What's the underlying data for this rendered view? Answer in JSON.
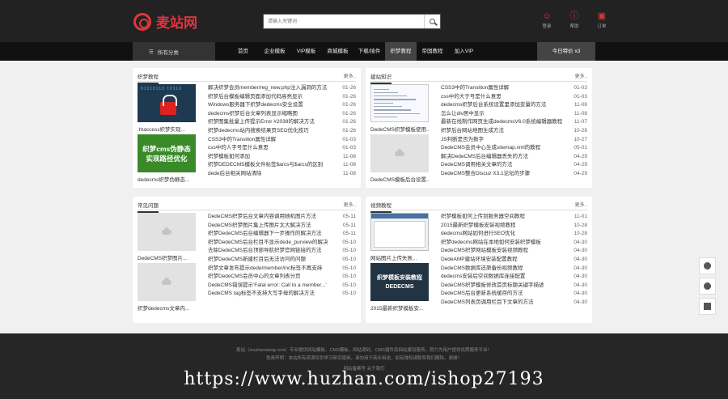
{
  "header": {
    "logo_text": "麦站网",
    "search_placeholder": "请输入关键词",
    "icons": [
      {
        "icon": "user-icon",
        "label": "登录"
      },
      {
        "icon": "help-icon",
        "label": "帮助"
      },
      {
        "icon": "cart-icon",
        "label": "订单"
      }
    ]
  },
  "nav": {
    "all_label": "所有分类",
    "items": [
      "首页",
      "企业模板",
      "VIP模板",
      "商城模板",
      "下载/插件",
      "织梦教程",
      "帝国教程"
    ],
    "active_index": 5,
    "extra": "加入VIP",
    "vip_label": "今日特价 x3"
  },
  "panels": [
    {
      "title": "织梦教程",
      "more": "更多..",
      "thumbs": [
        {
          "caption": ".htaccess织梦实现...",
          "style": "lock",
          "art": "01010110 10110"
        },
        {
          "caption": "dedecms织梦伪静态...",
          "style": "green",
          "art_lines": [
            "织梦cms伪静态",
            "实现路径优化"
          ]
        }
      ],
      "rows": [
        {
          "t": "解决织梦会员member/reg_new.php注入漏洞的方法",
          "d": "01-26"
        },
        {
          "t": "织梦后台模板编辑页面添加代码高亮显示",
          "d": "01-26"
        },
        {
          "t": "Windows服务器下织梦dedecms安全设置",
          "d": "01-26"
        },
        {
          "t": "dedecms织梦后台文章列表显示缩略图",
          "d": "01-26"
        },
        {
          "t": "织梦图集批量上传提示Error #2038的解决方法",
          "d": "01-26"
        },
        {
          "t": "织梦dedecms站内搜索结果页SEO优化技巧",
          "d": "01-26"
        },
        {
          "t": "CSS3中的Transition属性详解",
          "d": "01-03"
        },
        {
          "t": "css中的人字号是什么意思",
          "d": "01-03"
        },
        {
          "t": "织梦模板如何添加",
          "d": "11-08"
        },
        {
          "t": "织梦DEDECMS模板文件标签$arcs与$arcs的区别",
          "d": "11-08"
        },
        {
          "t": "dede后台相关网站清除",
          "d": "11-08"
        }
      ]
    },
    {
      "title": "建站知识",
      "more": "更多..",
      "thumbs": [
        {
          "caption": "DedeCMS织梦模板使用...",
          "style": "code"
        },
        {
          "caption": "DedeCMS模板后台设置...",
          "style": "placeholder"
        }
      ],
      "rows": [
        {
          "t": "CSS3中的Transition属性详解",
          "d": "01-03"
        },
        {
          "t": "css中的大于号是什么意思",
          "d": "01-03"
        },
        {
          "t": "dedecms织梦后台系统设置里添加变量的方法",
          "d": "11-08"
        },
        {
          "t": "怎么让div居中显示",
          "d": "11-08"
        },
        {
          "t": "最新在线制作网页生成dedecmsV6.0系统编辑器教程",
          "d": "11-07"
        },
        {
          "t": "织梦后台网站地图生成方法",
          "d": "10-28"
        },
        {
          "t": "JS判断是否为数字",
          "d": "10-27"
        },
        {
          "t": "DedeCMS会员中心生成sitemap.xml的教程",
          "d": "05-01"
        },
        {
          "t": "解决DedeCMS后台编辑器丢失的方法",
          "d": "04-29"
        },
        {
          "t": "DedeCMS调用相关文章的方法",
          "d": "04-29"
        },
        {
          "t": "DedeCMS整合Discuz X3.1论坛的步骤",
          "d": "04-29"
        }
      ]
    },
    {
      "title": "常见问题",
      "more": "更多..",
      "thumbs": [
        {
          "caption": "DedeCMS织梦图片...",
          "style": "placeholder"
        },
        {
          "caption": "织梦dedecms文章内...",
          "style": "placeholder"
        }
      ],
      "rows": [
        {
          "t": "DedeCMS织梦后台文章内容调用随机图片方法",
          "d": "05-11"
        },
        {
          "t": "DedeCMS织梦图片集上传图片太大解决方法",
          "d": "05-11"
        },
        {
          "t": "织梦DedeCMS后台编辑器下一步操作的解决方法",
          "d": "05-11"
        },
        {
          "t": "织梦DedeCMS后台栏目不显示dede_purview的解决",
          "d": "05-10"
        },
        {
          "t": "去除DedeCMS后台顶部导航织梦官网链接的方法",
          "d": "05-10"
        },
        {
          "t": "织梦DedeCMS新建栏目后无法访问的问题",
          "d": "05-10"
        },
        {
          "t": "织梦文章发布提示dede/member/inc标签不再支持",
          "d": "05-10"
        },
        {
          "t": "织梦DedeCMS会员中心的文章列表分页",
          "d": "05-10"
        },
        {
          "t": "DedeCMS错误提示'Fatal error: Call to a member...'",
          "d": "05-10"
        },
        {
          "t": "DedeCMS tag标签不支持大写字母的解决方法",
          "d": "05-10"
        }
      ]
    },
    {
      "title": "视频教程",
      "more": "更多..",
      "thumbs": [
        {
          "caption": "网站图片上传失败...",
          "style": "shot"
        },
        {
          "caption": "2015最新织梦模板安...",
          "style": "dede",
          "art_lines": [
            "织梦模板安装教程",
            "DEDECMS"
          ]
        }
      ],
      "rows": [
        {
          "t": "织梦模板如何上传到服务器空间教程",
          "d": "11-01"
        },
        {
          "t": "2015最新织梦模板安装视频教程",
          "d": "10-28"
        },
        {
          "t": "dedecms网站如何进行SEO优化",
          "d": "10-28"
        },
        {
          "t": "织梦dedecms网站在本地如何安装织梦模板",
          "d": "04-30"
        },
        {
          "t": "DedeCMS织梦网站模板安装视频教程",
          "d": "04-30"
        },
        {
          "t": "DedeAMP建站环境安装配置教程",
          "d": "04-30"
        },
        {
          "t": "DedeCMS数据库还原备份视频教程",
          "d": "04-30"
        },
        {
          "t": "dedecms安装后空间数据库连接配置",
          "d": "04-30"
        },
        {
          "t": "DedeCMS织梦模板修改首页标题关键字描述",
          "d": "04-30"
        },
        {
          "t": "DedeCMS后台更新系统缓存的方法",
          "d": "04-30"
        },
        {
          "t": "DedeCMS列表页调用栏目下文章的方法",
          "d": "04-30"
        }
      ]
    }
  ],
  "footer": {
    "line1": "麦站（xiuzhanwang.com）专业提供网站模板、CMS模板、网站源码、CMS插件及网站建设服务，努力为用户提供优质服务平台！",
    "line2": "免责声明：本站所有资源仅供学习研究使用，请勿用于商业用途，如有侵权请联系我们删除，谢谢！",
    "line3": "网站备案号 关于我们"
  },
  "watermark": "https://www.huzhan.com/ishop27193",
  "colors": {
    "brand": "#e0343b",
    "topbar": "#222222",
    "nav": "#111111"
  }
}
